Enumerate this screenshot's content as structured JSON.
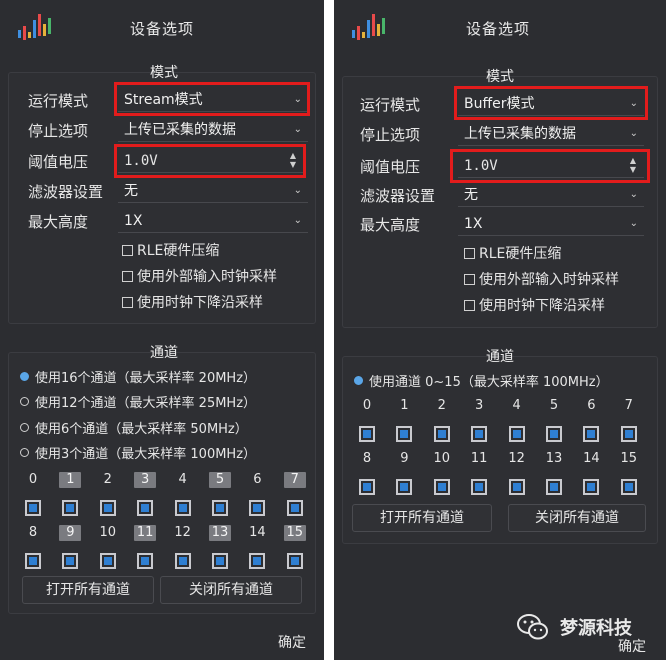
{
  "colors": {
    "panel_bg": "#2c2d31",
    "highlight": "#e21c1c",
    "accent": "#2f7fd2",
    "radio_on": "#5aa6e8"
  },
  "left": {
    "title": "设备选项",
    "mode_section": "模式",
    "labels": {
      "run_mode": "运行模式",
      "stop_option": "停止选项",
      "threshold": "阈值电压",
      "filter": "滤波器设置",
      "max_height": "最大高度"
    },
    "run_mode_value": "Stream模式",
    "stop_option_value": "上传已采集的数据",
    "threshold_value": "1.0V",
    "filter_value": "无",
    "max_height_value": "1X",
    "checkboxes": [
      "RLE硬件压缩",
      "使用外部输入时钟采样",
      "使用时钟下降沿采样"
    ],
    "channel_section": "通道",
    "radios": [
      "使用16个通道（最大采样率 20MHz）",
      "使用12个通道（最大采样率 25MHz）",
      "使用6个通道（最大采样率 50MHz）",
      "使用3个通道（最大采样率 100MHz）"
    ],
    "row1": [
      "0",
      "1",
      "2",
      "3",
      "4",
      "5",
      "6",
      "7"
    ],
    "row2": [
      "8",
      "9",
      "10",
      "11",
      "12",
      "13",
      "14",
      "15"
    ],
    "open_all": "打开所有通道",
    "close_all": "关闭所有通道",
    "ok": "确定"
  },
  "right": {
    "title": "设备选项",
    "mode_section": "模式",
    "labels": {
      "run_mode": "运行模式",
      "stop_option": "停止选项",
      "threshold": "阈值电压",
      "filter": "滤波器设置",
      "max_height": "最大高度"
    },
    "run_mode_value": "Buffer模式",
    "stop_option_value": "上传已采集的数据",
    "threshold_value": "1.0V",
    "filter_value": "无",
    "max_height_value": "1X",
    "checkboxes": [
      "RLE硬件压缩",
      "使用外部输入时钟采样",
      "使用时钟下降沿采样"
    ],
    "channel_section": "通道",
    "radio": "使用通道 0~15（最大采样率 100MHz）",
    "row1": [
      "0",
      "1",
      "2",
      "3",
      "4",
      "5",
      "6",
      "7"
    ],
    "row2": [
      "8",
      "9",
      "10",
      "11",
      "12",
      "13",
      "14",
      "15"
    ],
    "open_all": "打开所有通道",
    "close_all": "关闭所有通道",
    "ok": "确定"
  },
  "watermark": {
    "text": "梦源科技",
    "icon": "wechat-icon"
  }
}
